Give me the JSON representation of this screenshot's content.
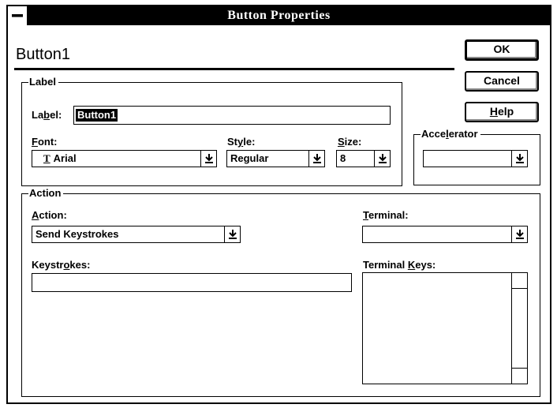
{
  "window": {
    "title": "Button Properties"
  },
  "header": {
    "name": "Button1"
  },
  "buttons": {
    "ok": "OK",
    "cancel": "Cancel",
    "help_pre": "",
    "help_u": "H",
    "help_post": "elp"
  },
  "label_group": {
    "legend": "Label",
    "label_pre": "La",
    "label_u": "b",
    "label_post": "el:",
    "label_value": "Button1",
    "font_u": "F",
    "font_post": "ont:",
    "font_value": "Arial",
    "font_icon": "truetype-icon",
    "style_pre": "St",
    "style_u": "y",
    "style_post": "le:",
    "style_value": "Regular",
    "size_u": "S",
    "size_post": "ize:",
    "size_value": "8"
  },
  "accelerator": {
    "legend_pre": "Acce",
    "legend_u": "l",
    "legend_post": "erator",
    "value": ""
  },
  "action_group": {
    "legend": "Action",
    "action_u": "A",
    "action_post": "ction:",
    "action_value": "Send Keystrokes",
    "keystrokes_pre": "Keystr",
    "keystrokes_u": "o",
    "keystrokes_post": "kes:",
    "keystrokes_value": "",
    "terminal_u": "T",
    "terminal_post": "erminal:",
    "terminal_value": "",
    "terminal_keys_pre": "Terminal ",
    "terminal_keys_u": "K",
    "terminal_keys_post": "eys:"
  },
  "icons": {
    "dropdown": "dropdown-arrow-icon",
    "system_menu": "system-menu-icon"
  }
}
